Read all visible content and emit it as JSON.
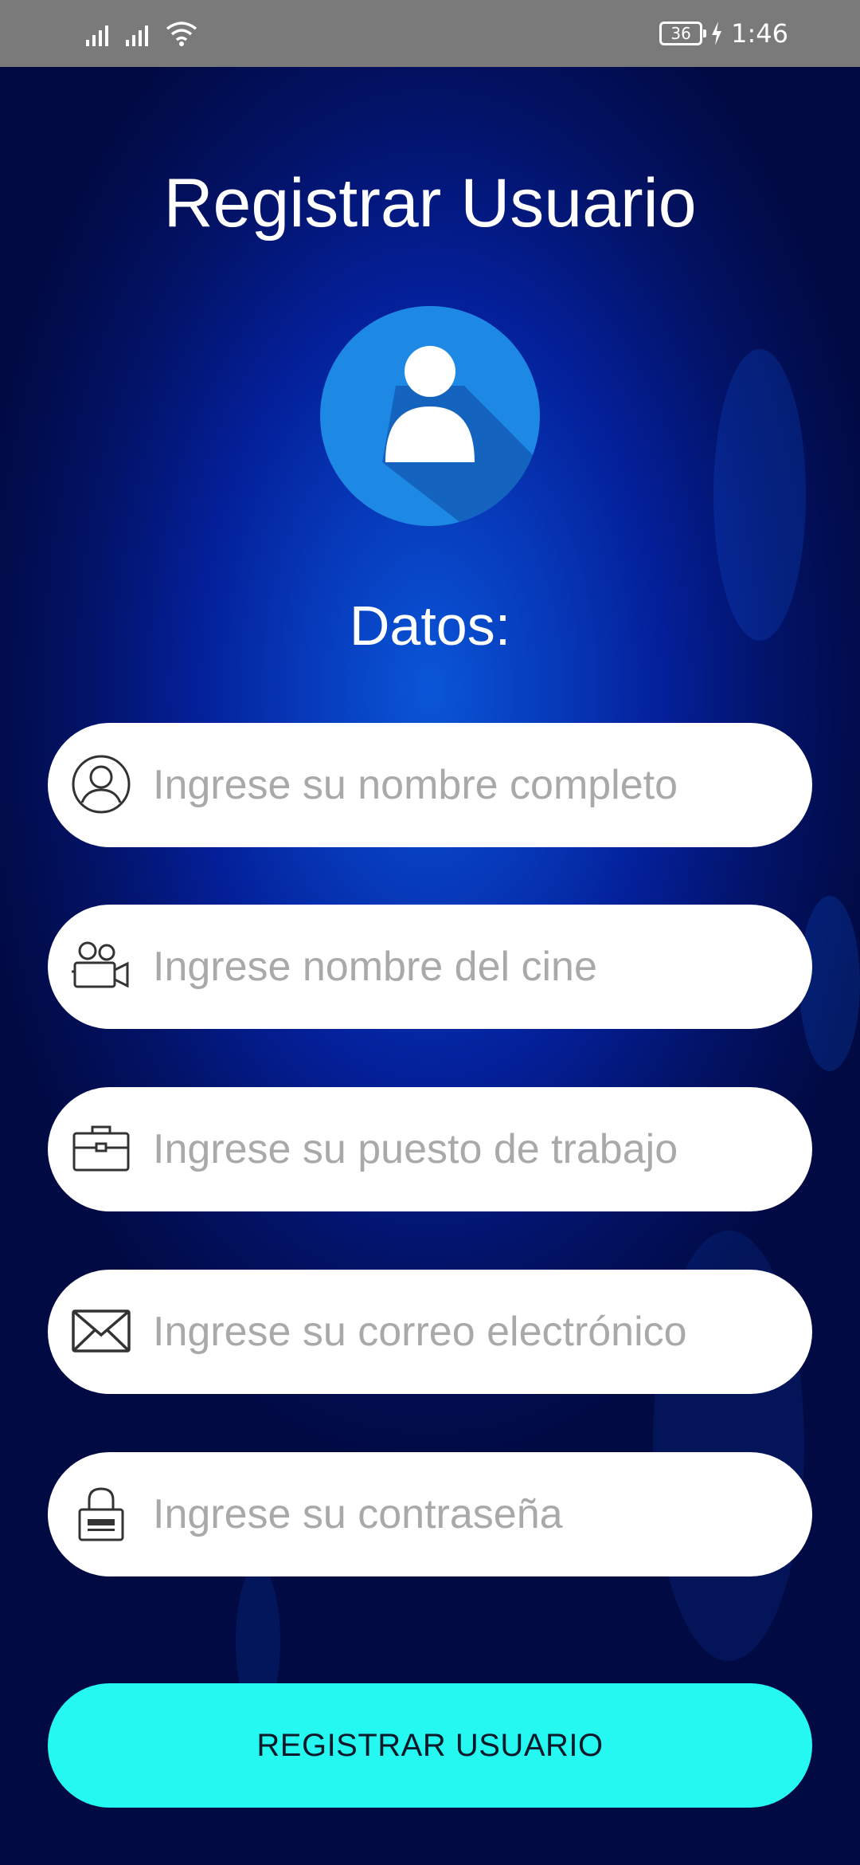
{
  "status_bar": {
    "battery_level": "36",
    "time": "1:46"
  },
  "form": {
    "title": "Registrar Usuario",
    "section_label": "Datos:",
    "fields": [
      {
        "placeholder": "Ingrese su nombre completo",
        "value": "",
        "icon": "user-circle-icon"
      },
      {
        "placeholder": "Ingrese nombre del cine",
        "value": "",
        "icon": "movie-camera-icon"
      },
      {
        "placeholder": "Ingrese su puesto de trabajo",
        "value": "",
        "icon": "briefcase-icon"
      },
      {
        "placeholder": "Ingrese su correo electrónico",
        "value": "",
        "icon": "envelope-icon"
      },
      {
        "placeholder": "Ingrese su contraseña",
        "value": "",
        "icon": "padlock-icon"
      }
    ],
    "submit_label": "REGISTRAR USUARIO"
  },
  "colors": {
    "background_center": "#0a56d8",
    "background_edge": "#010a42",
    "avatar_circle": "#1e88e5",
    "button_accent": "#25f8f0",
    "status_bar": "#7a7a7a",
    "placeholder_text": "#a9a9a9"
  }
}
